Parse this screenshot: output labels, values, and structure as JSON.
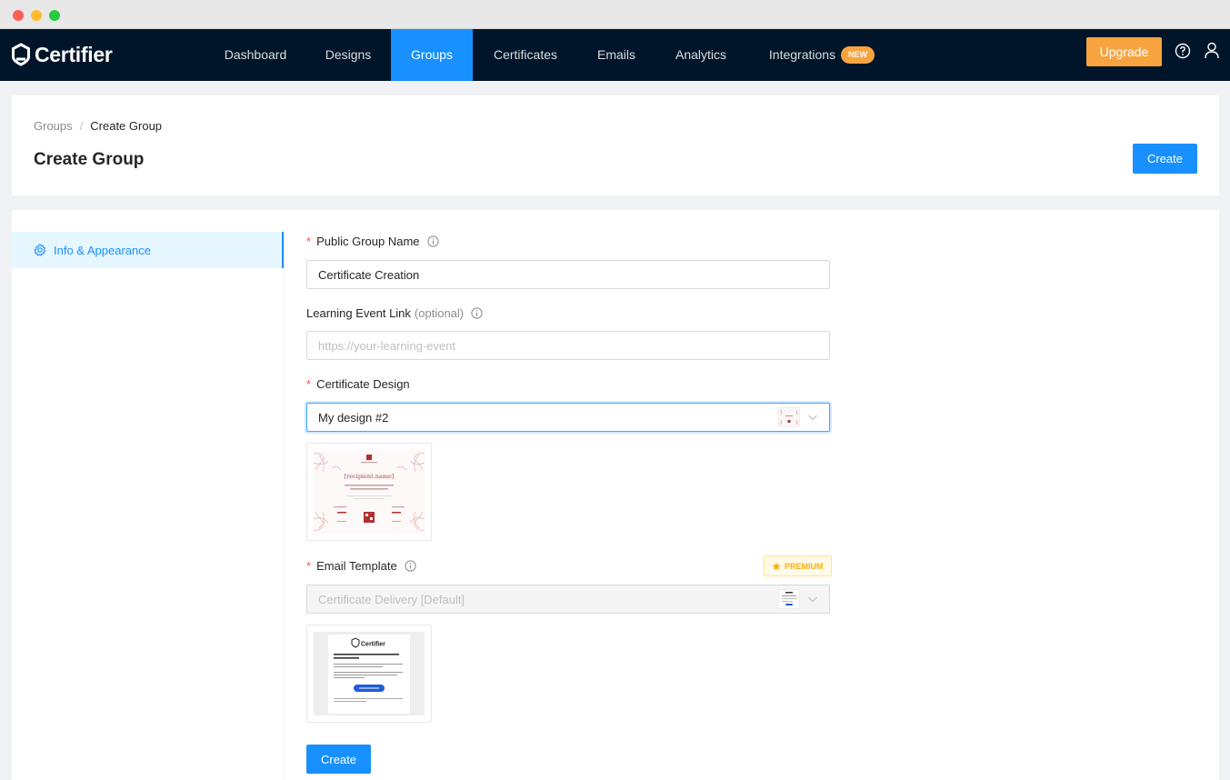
{
  "app": {
    "brand": "Certifier"
  },
  "nav": {
    "items": [
      {
        "label": "Dashboard",
        "active": false
      },
      {
        "label": "Designs",
        "active": false
      },
      {
        "label": "Groups",
        "active": true
      },
      {
        "label": "Certificates",
        "active": false
      },
      {
        "label": "Emails",
        "active": false
      },
      {
        "label": "Analytics",
        "active": false
      },
      {
        "label": "Integrations",
        "active": false,
        "badge": "NEW"
      }
    ],
    "upgrade_label": "Upgrade",
    "help_icon": "question-circle-icon",
    "user_icon": "user-icon"
  },
  "header": {
    "breadcrumb": {
      "parent": "Groups",
      "separator": "/",
      "current": "Create Group"
    },
    "title": "Create Group",
    "create_label": "Create"
  },
  "sidebar": {
    "items": [
      {
        "label": "Info & Appearance",
        "icon": "gear-icon",
        "active": true
      }
    ]
  },
  "form": {
    "group_name": {
      "label": "Public Group Name",
      "required": true,
      "value": "Certificate Creation"
    },
    "event_link": {
      "label": "Learning Event Link",
      "optional_text": "(optional)",
      "placeholder": "https://your-learning-event",
      "value": ""
    },
    "design": {
      "label": "Certificate Design",
      "required": true,
      "value": "My design #2"
    },
    "design_preview": {
      "recipient_placeholder": "[recipient.name]"
    },
    "email_template": {
      "label": "Email Template",
      "required": true,
      "value": "Certificate Delivery [Default]",
      "disabled": true,
      "premium_label": "PREMIUM"
    },
    "email_preview": {
      "logo": "Certifier"
    },
    "submit_label": "Create"
  },
  "colors": {
    "nav_bg": "#001529",
    "primary": "#1890ff",
    "upgrade": "#f7a440",
    "premium": "#faad14"
  }
}
